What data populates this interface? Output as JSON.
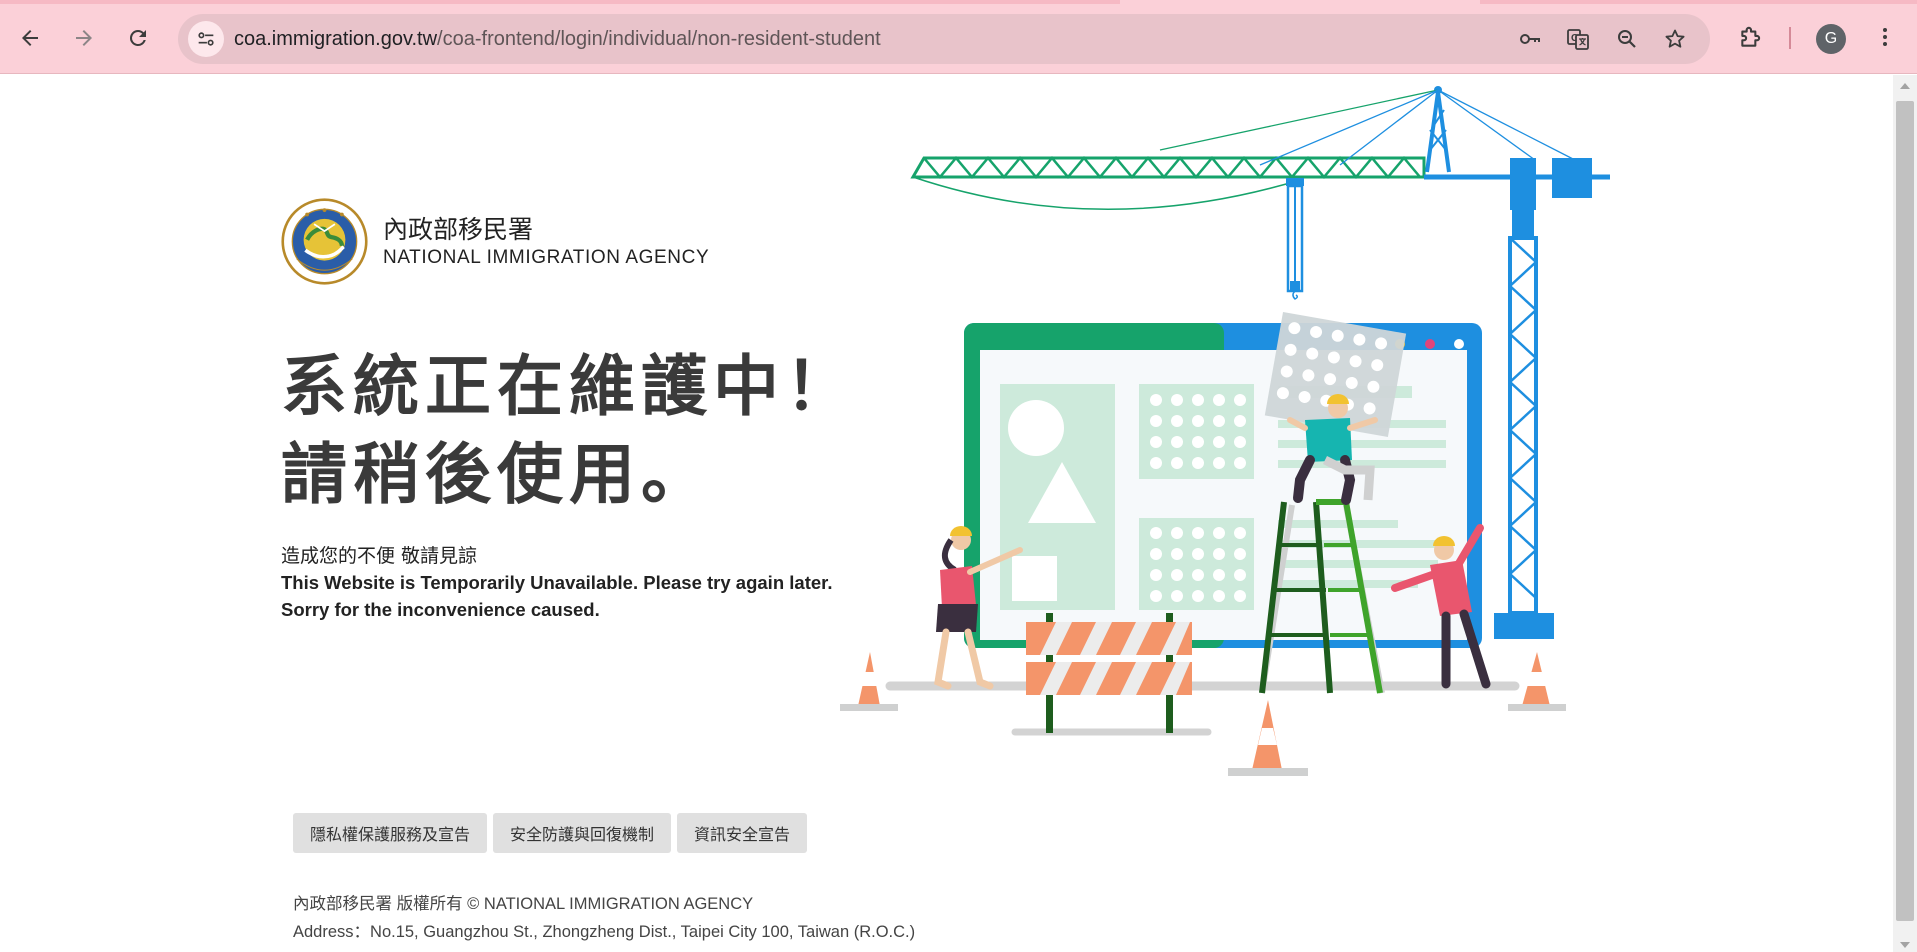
{
  "browser": {
    "url_host": "coa.immigration.gov.tw",
    "url_path": "/coa-frontend/login/individual/non-resident-student",
    "profile_initial": "G",
    "icons": {
      "back": "arrow-left-icon",
      "forward": "arrow-right-icon",
      "reload": "reload-icon",
      "site_info": "tune-icon",
      "password": "key-icon",
      "translate": "translate-icon",
      "zoom": "zoom-icon",
      "bookmark": "star-icon",
      "extensions": "puzzle-icon",
      "menu": "kebab-menu-icon"
    },
    "colors": {
      "frame": "#fbd0d8",
      "omnibox": "#e8c3ca"
    }
  },
  "header": {
    "agency_zh": "內政部移民署",
    "agency_en": "NATIONAL IMMIGRATION AGENCY",
    "logo_icon": "agency-seal-icon"
  },
  "notice": {
    "headline_line1": "系統正在維護中！",
    "headline_line2": "請稍後使用。",
    "apology_zh": "造成您的不便 敬請見諒",
    "apology_en_line1": "This Website is Temporarily Unavailable. Please try again later.",
    "apology_en_line2": "Sorry for the inconvenience caused."
  },
  "illustration": {
    "name": "under-construction-illustration",
    "colors": {
      "crane": "#1e8fe0",
      "crane_jib": "#16a36b",
      "cone": "#f4956a",
      "barrier": "#f4956a",
      "screen_frame": "#1e8fe0",
      "panel": "#cdeadb"
    }
  },
  "footer": {
    "links": [
      "隱私權保護服務及宣告",
      "安全防護與回復機制",
      "資訊安全宣告"
    ],
    "copyright": "內政部移民署 版權所有 © NATIONAL IMMIGRATION AGENCY",
    "address": "Address：No.15, Guangzhou St., Zhongzheng Dist., Taipei City 100, Taiwan (R.O.C.)"
  }
}
